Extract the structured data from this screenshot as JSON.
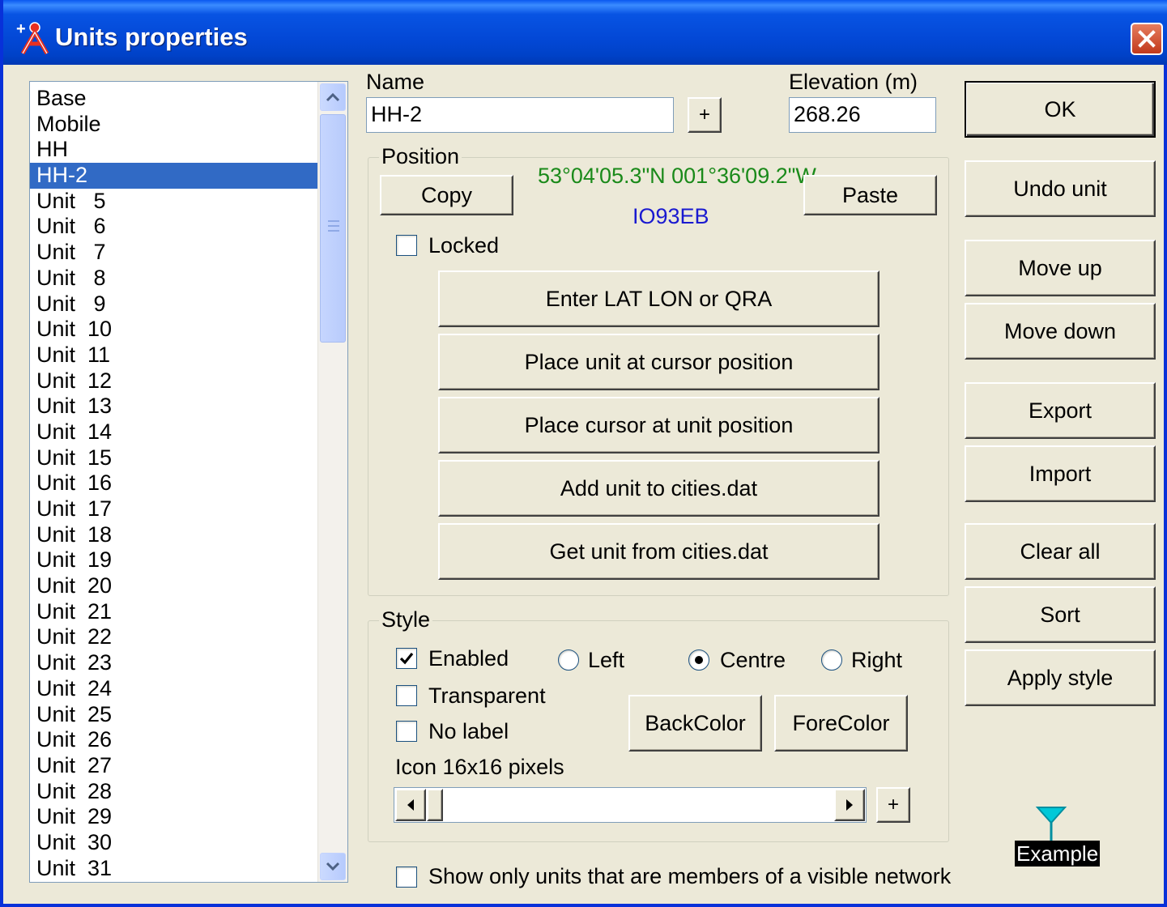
{
  "window": {
    "title": "Units properties",
    "icon": "units-app-icon",
    "close_icon": "close-icon",
    "accent": "#0a58f0",
    "close_color": "#c2391c"
  },
  "units_list": {
    "selected": "HH-2",
    "selected_color": "#316ac5",
    "items": [
      "Base",
      "Mobile",
      "HH",
      "HH-2",
      "Unit   5",
      "Unit   6",
      "Unit   7",
      "Unit   8",
      "Unit   9",
      "Unit  10",
      "Unit  11",
      "Unit  12",
      "Unit  13",
      "Unit  14",
      "Unit  15",
      "Unit  16",
      "Unit  17",
      "Unit  18",
      "Unit  19",
      "Unit  20",
      "Unit  21",
      "Unit  22",
      "Unit  23",
      "Unit  24",
      "Unit  25",
      "Unit  26",
      "Unit  27",
      "Unit  28",
      "Unit  29",
      "Unit  30",
      "Unit  31"
    ]
  },
  "name": {
    "label": "Name",
    "value": "HH-2",
    "add_label": "+"
  },
  "elevation": {
    "label": "Elevation (m)",
    "value": "268.26"
  },
  "position": {
    "label": "Position",
    "copy_label": "Copy",
    "paste_label": "Paste",
    "coords": "53°04'05.3\"N 001°36'09.2\"W",
    "coords_color": "#1a8a1a",
    "qra": "IO93EB",
    "qra_color": "#1a1ad0",
    "locked_label": "Locked",
    "locked": false,
    "buttons": [
      "Enter LAT LON or QRA",
      "Place unit at cursor position",
      "Place cursor at unit position",
      "Add unit to cities.dat",
      "Get unit from cities.dat"
    ]
  },
  "style": {
    "label": "Style",
    "enabled_label": "Enabled",
    "enabled": true,
    "transparent_label": "Transparent",
    "transparent": false,
    "nolabel_label": "No label",
    "nolabel": false,
    "align_left": "Left",
    "align_centre": "Centre",
    "align_right": "Right",
    "alignment": "Centre",
    "backcolor_label": "BackColor",
    "forecolor_label": "ForeColor",
    "icon_label": "Icon 16x16 pixels",
    "icon_plus": "+"
  },
  "show_only_label": "Show only units that are members of a visible network",
  "show_only": false,
  "side_buttons": {
    "ok": "OK",
    "undo": "Undo unit",
    "move_up": "Move up",
    "move_down": "Move down",
    "export": "Export",
    "import": "Import",
    "clear_all": "Clear all",
    "sort": "Sort",
    "apply_style": "Apply style"
  },
  "example": {
    "label": "Example",
    "icon": "antenna-icon",
    "icon_color": "#00c8d8"
  }
}
